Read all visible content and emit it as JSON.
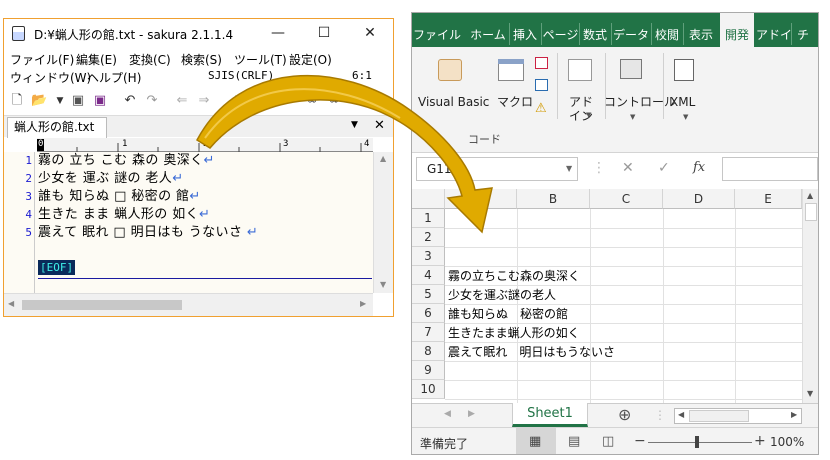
{
  "sakura": {
    "title": "D:¥蝋人形の館.txt - sakura 2.1.1.4",
    "window_controls": {
      "minimize": "—",
      "maximize": "☐",
      "close": "✕"
    },
    "menu": [
      "ファイル(F)",
      "編集(E)",
      "変換(C)",
      "検索(S)",
      "ツール(T)",
      "設定(O)"
    ],
    "menu2": [
      "ウィンドウ(W)",
      "ヘルプ(H)"
    ],
    "encoding": "SJIS(CRLF)",
    "position": "6:1",
    "tab_label": "蝋人形の館.txt",
    "tab_dropdown": "▼",
    "tab_close": "✕",
    "ruler": {
      "marks": [
        "0",
        "1",
        "2",
        "3",
        "4"
      ]
    },
    "lines": [
      {
        "num": "1",
        "text": "霧の 立ち こむ 森の 奥深く"
      },
      {
        "num": "2",
        "text": "少女を 運ぶ 謎の 老人"
      },
      {
        "num": "3",
        "text": "誰も 知らぬ □ 秘密の 館"
      },
      {
        "num": "4",
        "text": "生きた まま 蝋人形の 如く"
      },
      {
        "num": "5",
        "text": "震えて 眠れ □ 明日はも うないさ"
      }
    ],
    "return_mark": "↵",
    "eof": "[EOF]"
  },
  "excel": {
    "tabs": [
      "ファイル",
      "ホーム",
      "挿入",
      "ページ",
      "数式",
      "データ",
      "校閲",
      "表示",
      "開発",
      "アドイ",
      "チ"
    ],
    "active_tab": "開発",
    "ribbon": {
      "visual_basic": "Visual Basic",
      "macro": "マクロ",
      "addin": "アドイン",
      "control": "コントロール",
      "xml": "XML",
      "group_label": "コード"
    },
    "name_box": "G11",
    "fx": "fx",
    "columns": [
      "B",
      "C",
      "D",
      "E"
    ],
    "rows": [
      "1",
      "2",
      "3",
      "4",
      "5",
      "6",
      "7",
      "8",
      "9",
      "10"
    ],
    "cells": [
      {
        "row": 4,
        "text": "霧の立ちこむ森の奥深く"
      },
      {
        "row": 5,
        "text": "少女を運ぶ謎の老人"
      },
      {
        "row": 6,
        "text": "誰も知らぬ　秘密の館"
      },
      {
        "row": 7,
        "text": "生きたまま蝋人形の如く"
      },
      {
        "row": 8,
        "text": "震えて眠れ　明日はもうないさ"
      }
    ],
    "sheet_tab": "Sheet1",
    "add_sheet": "⊕",
    "status": "準備完了",
    "zoom": "100%"
  },
  "colors": {
    "excel_green": "#217346",
    "arrow_gold": "#d9a300",
    "sakura_border": "#f0a030"
  }
}
